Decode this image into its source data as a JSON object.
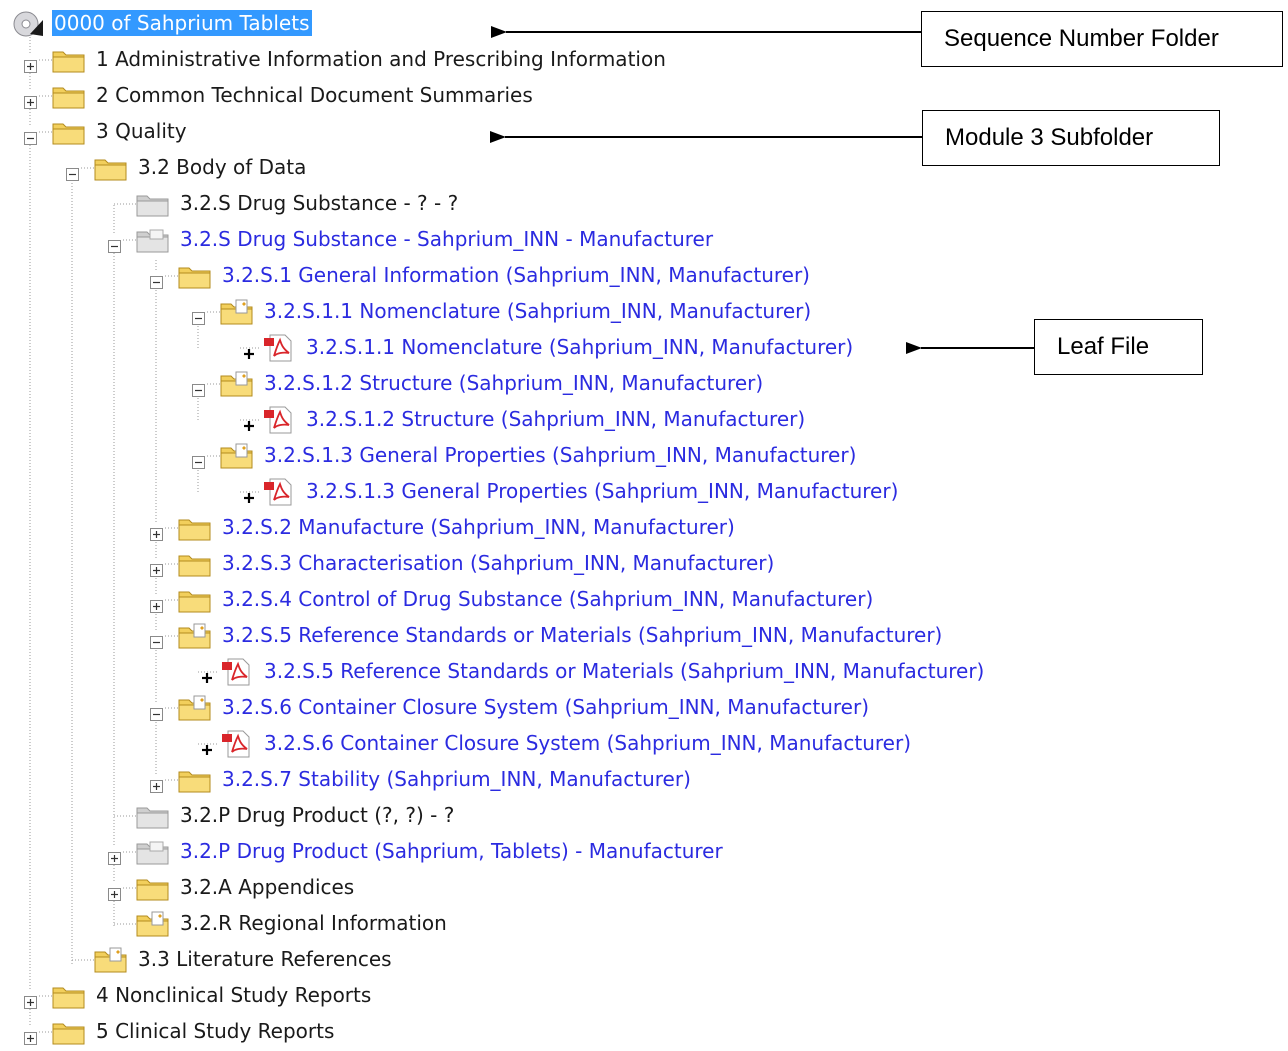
{
  "tree": {
    "root_label": "0000 of Sahprium Tablets",
    "nodes": [
      {
        "label": "1 Administrative Information and Prescribing Information",
        "icon": "folder-icon",
        "expander": "plus"
      },
      {
        "label": "2 Common Technical Document Summaries",
        "icon": "folder-icon",
        "expander": "plus"
      },
      {
        "label": "3 Quality",
        "icon": "folder-icon",
        "expander": "minus"
      },
      {
        "label": "3.2 Body of Data",
        "icon": "folder-icon",
        "expander": "minus"
      },
      {
        "label": "3.2.S Drug Substance - ? - ?",
        "icon": "grey-folder-icon",
        "expander": "none"
      },
      {
        "label": "3.2.S Drug Substance - Sahprium_INN - Manufacturer",
        "icon": "grey-folder-open-icon",
        "expander": "minus"
      },
      {
        "label": "3.2.S.1 General Information (Sahprium_INN, Manufacturer)",
        "icon": "folder-icon",
        "expander": "minus"
      },
      {
        "label": "3.2.S.1.1 Nomenclature (Sahprium_INN, Manufacturer)",
        "icon": "folder-doc-icon",
        "expander": "minus"
      },
      {
        "label": "3.2.S.1.1 Nomenclature (Sahprium_INN, Manufacturer)",
        "icon": "pdf-icon",
        "expander": "leaf"
      },
      {
        "label": "3.2.S.1.2 Structure (Sahprium_INN, Manufacturer)",
        "icon": "folder-doc-icon",
        "expander": "minus"
      },
      {
        "label": "3.2.S.1.2 Structure (Sahprium_INN, Manufacturer)",
        "icon": "pdf-icon",
        "expander": "leaf"
      },
      {
        "label": "3.2.S.1.3 General Properties (Sahprium_INN, Manufacturer)",
        "icon": "folder-doc-icon",
        "expander": "minus"
      },
      {
        "label": "3.2.S.1.3 General Properties (Sahprium_INN, Manufacturer)",
        "icon": "pdf-icon",
        "expander": "leaf"
      },
      {
        "label": "3.2.S.2 Manufacture (Sahprium_INN, Manufacturer)",
        "icon": "folder-icon",
        "expander": "plus"
      },
      {
        "label": "3.2.S.3 Characterisation (Sahprium_INN, Manufacturer)",
        "icon": "folder-icon",
        "expander": "plus"
      },
      {
        "label": "3.2.S.4 Control of Drug Substance (Sahprium_INN, Manufacturer)",
        "icon": "folder-icon",
        "expander": "plus"
      },
      {
        "label": "3.2.S.5 Reference Standards or Materials (Sahprium_INN, Manufacturer)",
        "icon": "folder-doc-icon",
        "expander": "minus"
      },
      {
        "label": "3.2.S.5 Reference Standards or Materials (Sahprium_INN, Manufacturer)",
        "icon": "pdf-icon",
        "expander": "leaf"
      },
      {
        "label": "3.2.S.6 Container Closure System (Sahprium_INN, Manufacturer)",
        "icon": "folder-doc-icon",
        "expander": "minus"
      },
      {
        "label": "3.2.S.6 Container Closure System (Sahprium_INN, Manufacturer)",
        "icon": "pdf-icon",
        "expander": "leaf"
      },
      {
        "label": "3.2.S.7 Stability (Sahprium_INN, Manufacturer)",
        "icon": "folder-icon",
        "expander": "plus"
      },
      {
        "label": "3.2.P Drug Product (?, ?) - ?",
        "icon": "grey-folder-icon",
        "expander": "none"
      },
      {
        "label": "3.2.P Drug Product (Sahprium, Tablets) - Manufacturer",
        "icon": "grey-folder-open-icon",
        "expander": "plus"
      },
      {
        "label": "3.2.A Appendices",
        "icon": "folder-icon",
        "expander": "plus"
      },
      {
        "label": "3.2.R Regional Information",
        "icon": "folder-doc-icon",
        "expander": "none"
      },
      {
        "label": "3.3 Literature References",
        "icon": "folder-doc-icon",
        "expander": "none"
      },
      {
        "label": "4 Nonclinical Study Reports",
        "icon": "folder-icon",
        "expander": "plus"
      },
      {
        "label": "5 Clinical Study Reports",
        "icon": "folder-icon",
        "expander": "plus"
      }
    ]
  },
  "callouts": {
    "sequence": "Sequence Number Folder",
    "module3": "Module 3 Subfolder",
    "leaf": "Leaf File"
  },
  "colors": {
    "selection": "#3399ff",
    "link_text": "#2b2be0",
    "folder": "#f2cf5c",
    "pdf": "#d9252a"
  }
}
